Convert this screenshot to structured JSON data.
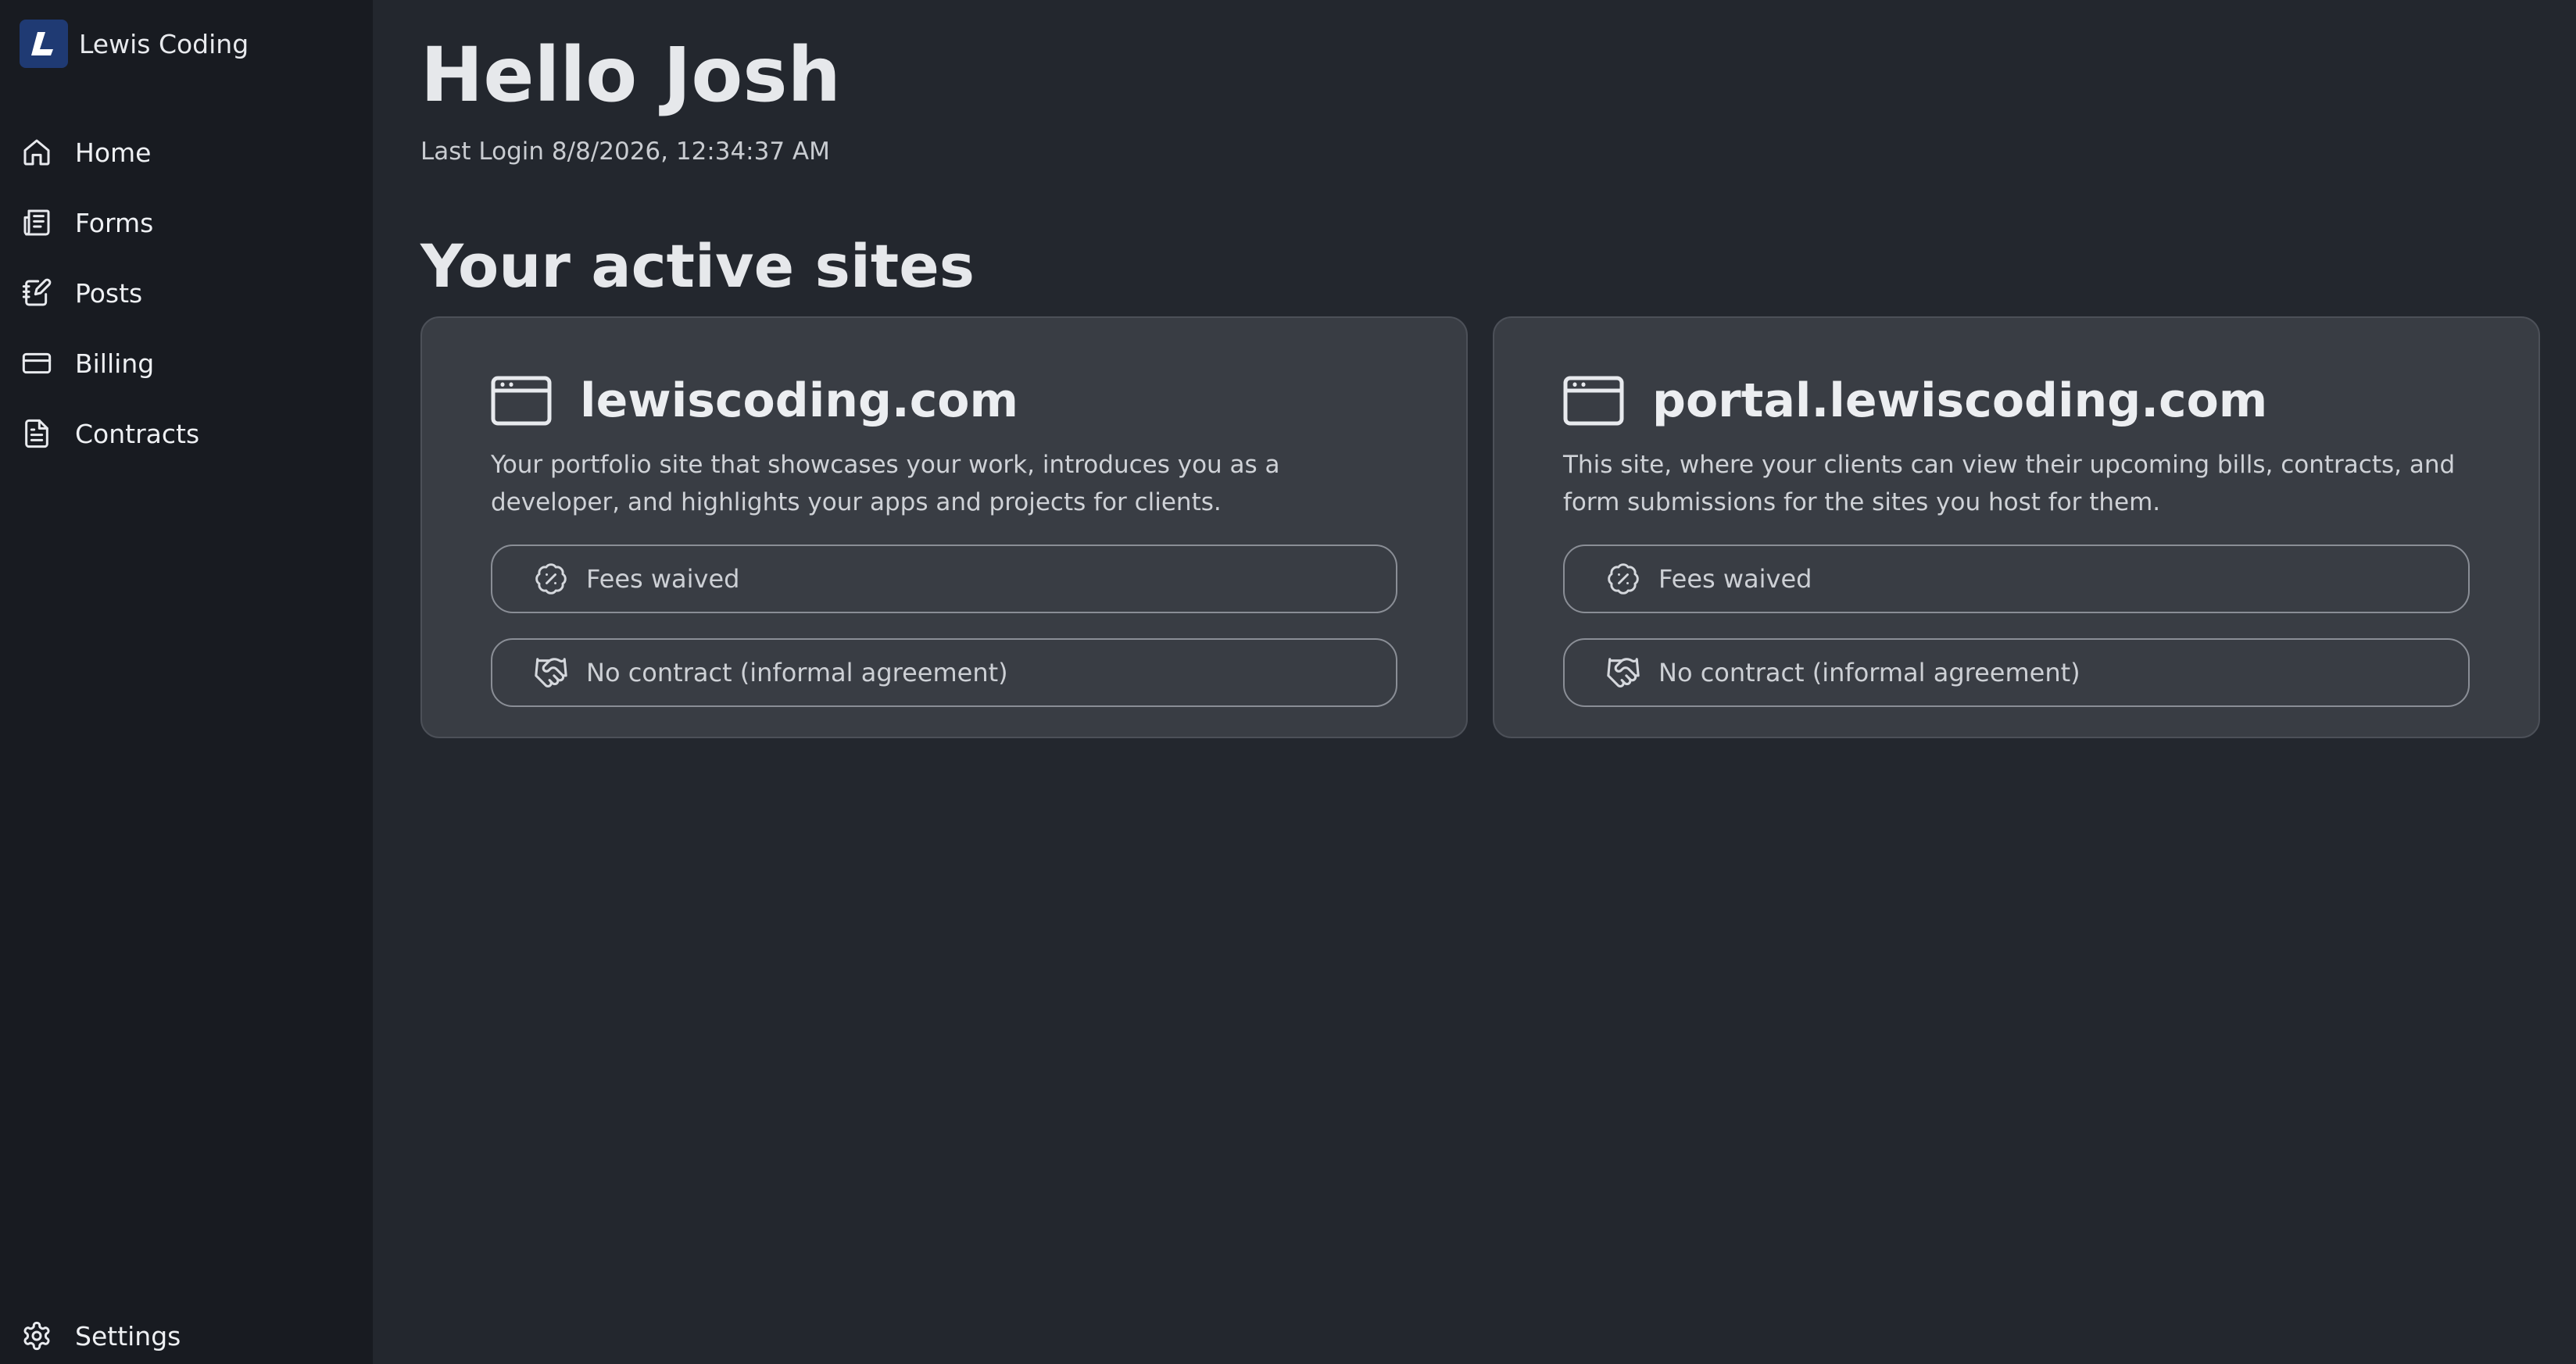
{
  "brand": {
    "name": "Lewis Coding",
    "logo_icon": "lewis-coding-logo"
  },
  "sidebar": {
    "items": [
      {
        "label": "Home",
        "icon": "home-icon"
      },
      {
        "label": "Forms",
        "icon": "newspaper-icon"
      },
      {
        "label": "Posts",
        "icon": "notebook-pen-icon"
      },
      {
        "label": "Billing",
        "icon": "credit-card-icon"
      },
      {
        "label": "Contracts",
        "icon": "document-icon"
      }
    ],
    "settings": {
      "label": "Settings",
      "icon": "gear-icon"
    }
  },
  "header": {
    "greeting": "Hello Josh",
    "last_login": "Last Login 8/8/2026, 12:34:37 AM"
  },
  "sites": {
    "title": "Your active sites",
    "cards": [
      {
        "name": "lewiscoding.com",
        "icon": "browser-window-icon",
        "description": "Your portfolio site that showcases your work, introduces you as a developer, and highlights your apps and projects for clients.",
        "fees": "Fees waived",
        "contract": "No contract (informal agreement)"
      },
      {
        "name": "portal.lewiscoding.com",
        "icon": "browser-window-icon",
        "description": "This site, where your clients can view their upcoming bills, contracts, and form submissions for the sites you host for them.",
        "fees": "Fees waived",
        "contract": "No contract (informal agreement)"
      }
    ]
  },
  "colors": {
    "sidebar_bg": "#181b21",
    "main_bg": "#23272e",
    "card_bg": "#393d44",
    "logo_bg": "#1f3a73"
  }
}
